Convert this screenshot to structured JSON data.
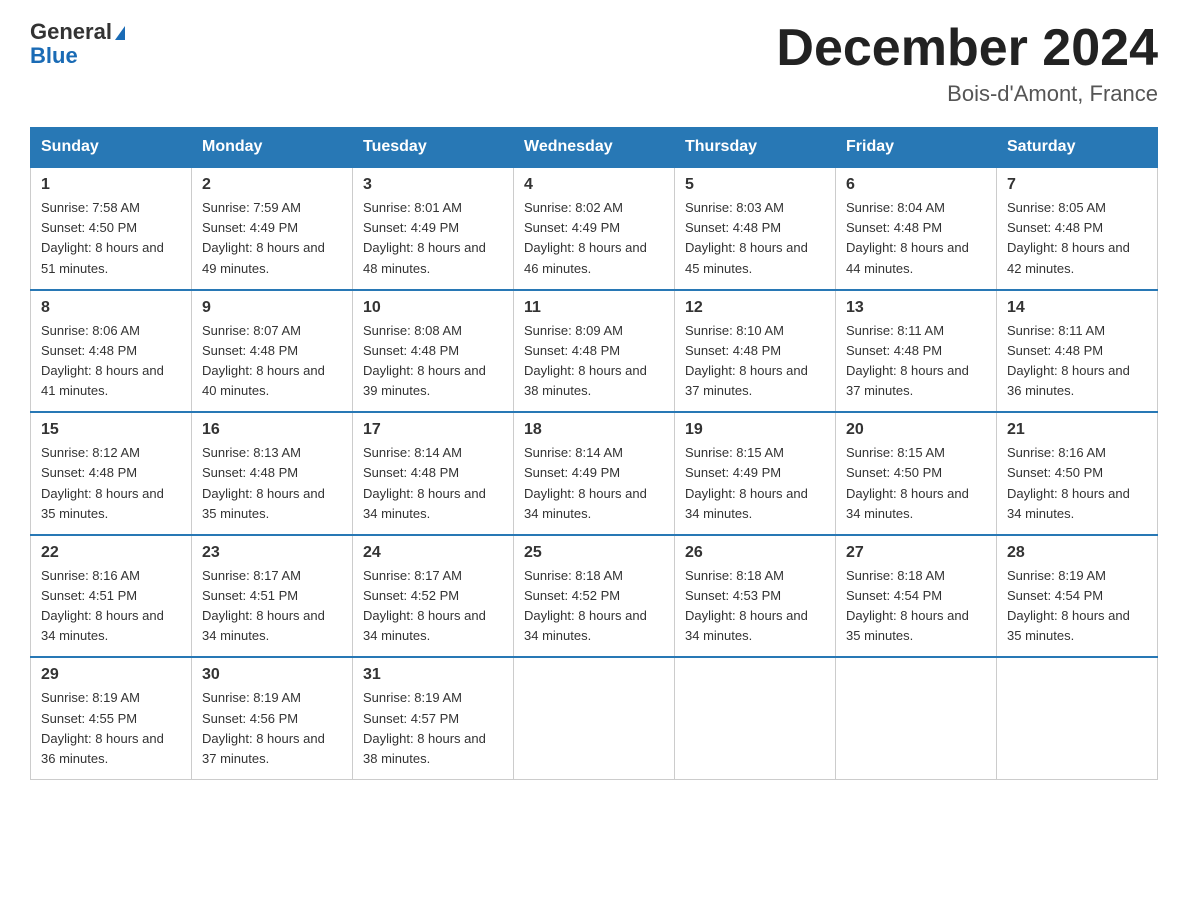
{
  "logo": {
    "general": "General",
    "blue": "Blue"
  },
  "title": "December 2024",
  "location": "Bois-d'Amont, France",
  "days_of_week": [
    "Sunday",
    "Monday",
    "Tuesday",
    "Wednesday",
    "Thursday",
    "Friday",
    "Saturday"
  ],
  "weeks": [
    [
      {
        "day": "1",
        "sunrise": "7:58 AM",
        "sunset": "4:50 PM",
        "daylight": "8 hours and 51 minutes."
      },
      {
        "day": "2",
        "sunrise": "7:59 AM",
        "sunset": "4:49 PM",
        "daylight": "8 hours and 49 minutes."
      },
      {
        "day": "3",
        "sunrise": "8:01 AM",
        "sunset": "4:49 PM",
        "daylight": "8 hours and 48 minutes."
      },
      {
        "day": "4",
        "sunrise": "8:02 AM",
        "sunset": "4:49 PM",
        "daylight": "8 hours and 46 minutes."
      },
      {
        "day": "5",
        "sunrise": "8:03 AM",
        "sunset": "4:48 PM",
        "daylight": "8 hours and 45 minutes."
      },
      {
        "day": "6",
        "sunrise": "8:04 AM",
        "sunset": "4:48 PM",
        "daylight": "8 hours and 44 minutes."
      },
      {
        "day": "7",
        "sunrise": "8:05 AM",
        "sunset": "4:48 PM",
        "daylight": "8 hours and 42 minutes."
      }
    ],
    [
      {
        "day": "8",
        "sunrise": "8:06 AM",
        "sunset": "4:48 PM",
        "daylight": "8 hours and 41 minutes."
      },
      {
        "day": "9",
        "sunrise": "8:07 AM",
        "sunset": "4:48 PM",
        "daylight": "8 hours and 40 minutes."
      },
      {
        "day": "10",
        "sunrise": "8:08 AM",
        "sunset": "4:48 PM",
        "daylight": "8 hours and 39 minutes."
      },
      {
        "day": "11",
        "sunrise": "8:09 AM",
        "sunset": "4:48 PM",
        "daylight": "8 hours and 38 minutes."
      },
      {
        "day": "12",
        "sunrise": "8:10 AM",
        "sunset": "4:48 PM",
        "daylight": "8 hours and 37 minutes."
      },
      {
        "day": "13",
        "sunrise": "8:11 AM",
        "sunset": "4:48 PM",
        "daylight": "8 hours and 37 minutes."
      },
      {
        "day": "14",
        "sunrise": "8:11 AM",
        "sunset": "4:48 PM",
        "daylight": "8 hours and 36 minutes."
      }
    ],
    [
      {
        "day": "15",
        "sunrise": "8:12 AM",
        "sunset": "4:48 PM",
        "daylight": "8 hours and 35 minutes."
      },
      {
        "day": "16",
        "sunrise": "8:13 AM",
        "sunset": "4:48 PM",
        "daylight": "8 hours and 35 minutes."
      },
      {
        "day": "17",
        "sunrise": "8:14 AM",
        "sunset": "4:48 PM",
        "daylight": "8 hours and 34 minutes."
      },
      {
        "day": "18",
        "sunrise": "8:14 AM",
        "sunset": "4:49 PM",
        "daylight": "8 hours and 34 minutes."
      },
      {
        "day": "19",
        "sunrise": "8:15 AM",
        "sunset": "4:49 PM",
        "daylight": "8 hours and 34 minutes."
      },
      {
        "day": "20",
        "sunrise": "8:15 AM",
        "sunset": "4:50 PM",
        "daylight": "8 hours and 34 minutes."
      },
      {
        "day": "21",
        "sunrise": "8:16 AM",
        "sunset": "4:50 PM",
        "daylight": "8 hours and 34 minutes."
      }
    ],
    [
      {
        "day": "22",
        "sunrise": "8:16 AM",
        "sunset": "4:51 PM",
        "daylight": "8 hours and 34 minutes."
      },
      {
        "day": "23",
        "sunrise": "8:17 AM",
        "sunset": "4:51 PM",
        "daylight": "8 hours and 34 minutes."
      },
      {
        "day": "24",
        "sunrise": "8:17 AM",
        "sunset": "4:52 PM",
        "daylight": "8 hours and 34 minutes."
      },
      {
        "day": "25",
        "sunrise": "8:18 AM",
        "sunset": "4:52 PM",
        "daylight": "8 hours and 34 minutes."
      },
      {
        "day": "26",
        "sunrise": "8:18 AM",
        "sunset": "4:53 PM",
        "daylight": "8 hours and 34 minutes."
      },
      {
        "day": "27",
        "sunrise": "8:18 AM",
        "sunset": "4:54 PM",
        "daylight": "8 hours and 35 minutes."
      },
      {
        "day": "28",
        "sunrise": "8:19 AM",
        "sunset": "4:54 PM",
        "daylight": "8 hours and 35 minutes."
      }
    ],
    [
      {
        "day": "29",
        "sunrise": "8:19 AM",
        "sunset": "4:55 PM",
        "daylight": "8 hours and 36 minutes."
      },
      {
        "day": "30",
        "sunrise": "8:19 AM",
        "sunset": "4:56 PM",
        "daylight": "8 hours and 37 minutes."
      },
      {
        "day": "31",
        "sunrise": "8:19 AM",
        "sunset": "4:57 PM",
        "daylight": "8 hours and 38 minutes."
      },
      null,
      null,
      null,
      null
    ]
  ],
  "labels": {
    "sunrise": "Sunrise:",
    "sunset": "Sunset:",
    "daylight": "Daylight:"
  }
}
